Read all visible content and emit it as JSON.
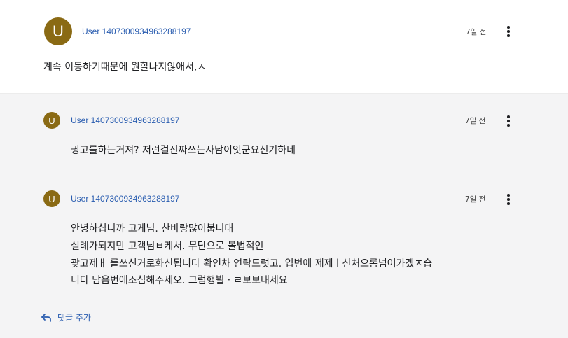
{
  "main_comment": {
    "avatar_letter": "U",
    "username": "User 1407300934963288197",
    "time": "7일 전",
    "text": "계속 이동하기때문에 원할나지않애서,ㅈ"
  },
  "replies": [
    {
      "username": "User 1407300934963288197",
      "time": "7일 전",
      "lines": [
        "귕고를하는거져?  저런걸진짜쓰는사남이잇군요신기하네"
      ]
    },
    {
      "username": "User 1407300934963288197",
      "time": "7일 전",
      "lines": [
        "안녕하십니까 고게님. 찬바랑많이붑니대",
        "실례가되지만 고객님ㅂ케서. 무단으로 볼법적인",
        "괒고제ㅐ 를쓰신거로화신됩니다 확인차 연락드럿고. 입번에 제제ㅣ신처으롬넘어가겠ㅈ습",
        "니다 담음번에조심해주세오. 그럼행뵐ㆍㄹ보보내세요"
      ]
    }
  ],
  "add_reply_label": "댓글 추가",
  "icons": {
    "more": "more-vert-icon",
    "reply": "reply-arrow-icon"
  },
  "colors": {
    "avatar": "#8a6a14",
    "link": "#2a5db0",
    "thread_bg": "#f4f4f5"
  }
}
